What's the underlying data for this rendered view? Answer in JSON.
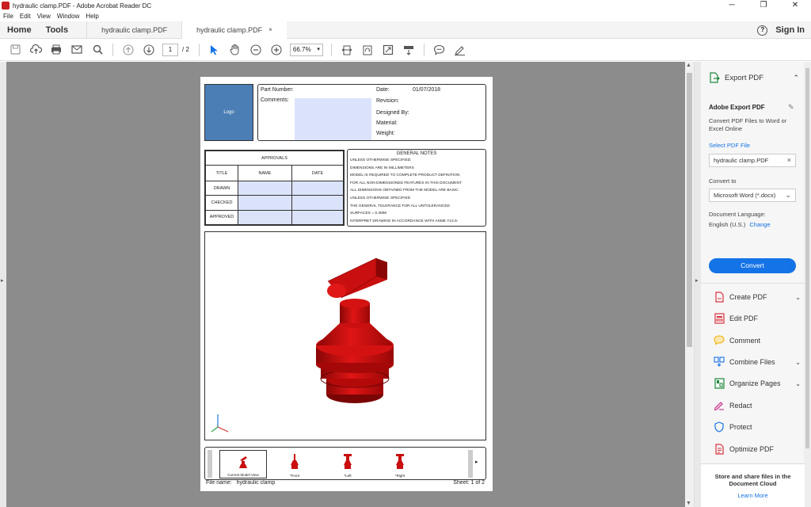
{
  "window": {
    "title": "hydraulic clamp.PDF - Adobe Acrobat Reader DC",
    "controls": {
      "minimize": "─",
      "restore": "❐",
      "close": "✕"
    }
  },
  "menu": [
    "File",
    "Edit",
    "View",
    "Window",
    "Help"
  ],
  "tabs": {
    "home": "Home",
    "tools": "Tools",
    "docs": [
      {
        "label": "hydraulic clamp.PDF",
        "active": false
      },
      {
        "label": "hydraulic clamp.PDF",
        "active": true,
        "close": "×"
      }
    ],
    "help": "?",
    "signin": "Sign In"
  },
  "toolbar": {
    "page_current": "1",
    "page_total": "/  2",
    "zoom": "66.7%",
    "icons": [
      "save-icon",
      "upload-icon",
      "print-icon",
      "email-icon",
      "search-icon",
      "page-up-icon",
      "page-down-icon",
      "select-arrow-icon",
      "hand-icon",
      "zoom-out-icon",
      "zoom-in-icon",
      "fit-width-icon",
      "rotate-icon",
      "full-screen-icon",
      "scroll-mode-icon",
      "comment-icon",
      "sign-icon"
    ]
  },
  "document": {
    "logo": "Logo",
    "part_number_label": "Part Number:",
    "comments_label": "Comments:",
    "date_label": "Date:",
    "date_value": "01/07/2018",
    "revision_label": "Revision:",
    "designed_by_label": "Designed By:",
    "material_label": "Material:",
    "weight_label": "Weight:",
    "approvals": {
      "title": "APPROVALS",
      "headers": [
        "TITLE",
        "NAME",
        "DATE"
      ],
      "rows": [
        "DRAWN",
        "CHECKED",
        "APPROVED"
      ]
    },
    "notes": {
      "title": "GENERAL NOTES",
      "lines": [
        "UNLESS OTHERWISE SPECIFIED:",
        "DIMENSIONS ARE IN MILLIMETERS",
        "MODEL IS REQUIRED TO COMPLETE PRODUCT DEFINITION",
        "FOR ALL NON-DIMENSIONED FEATURES IN THIS DOCUMENT",
        "ALL DIMENSIONS OBTAINED FROM THE MODEL ARE BASIC",
        "UNLESS OTHERWISE SPECIFIED",
        "THE GENERAL TOLERANCE FOR ALL UNTOLERANCED",
        "SURFACES = 0.2MM",
        "INTERPRET DRAWING IN ACCORDANCE WITH ASME Y14.5-"
      ]
    },
    "views": [
      {
        "label": "Current Model View",
        "selected": true
      },
      {
        "label": "*Front",
        "selected": false
      },
      {
        "label": "*Left",
        "selected": false
      },
      {
        "label": "*Right",
        "selected": false
      }
    ],
    "views_next": "▸",
    "file_name_label": "File name:",
    "file_name_value": "hydraulic clamp",
    "sheet": "Sheet: 1  of 2",
    "model_color": "#d10d0d"
  },
  "right_panel": {
    "export_header": "Export PDF",
    "export_title": "Adobe Export PDF",
    "export_desc": "Convert PDF Files to Word or Excel Online",
    "select_file_label": "Select PDF File",
    "selected_file": "hydraulic clamp.PDF",
    "convert_to_label": "Convert to",
    "convert_to_value": "Microsoft Word (*.docx)",
    "doc_language_label": "Document Language:",
    "doc_language_value": "English (U.S.)",
    "change_link": "Change",
    "convert_button": "Convert",
    "tools": [
      {
        "label": "Create PDF",
        "icon": "create-pdf-icon",
        "chevron": true,
        "color": "#d9333f"
      },
      {
        "label": "Edit PDF",
        "icon": "edit-pdf-icon",
        "chevron": false,
        "color": "#d9333f"
      },
      {
        "label": "Comment",
        "icon": "comment-bubble-icon",
        "chevron": false,
        "color": "#f2b20f"
      },
      {
        "label": "Combine Files",
        "icon": "combine-files-icon",
        "chevron": true,
        "color": "#1473e6"
      },
      {
        "label": "Organize Pages",
        "icon": "organize-pages-icon",
        "chevron": true,
        "color": "#1f8a3b"
      },
      {
        "label": "Redact",
        "icon": "redact-icon",
        "chevron": false,
        "color": "#c5338c"
      },
      {
        "label": "Protect",
        "icon": "protect-shield-icon",
        "chevron": false,
        "color": "#1473e6"
      },
      {
        "label": "Optimize PDF",
        "icon": "optimize-pdf-icon",
        "chevron": false,
        "color": "#d9333f"
      }
    ],
    "store_text": "Store and share files in the Document Cloud",
    "learn_more": "Learn More",
    "accent": "#1473e6"
  }
}
